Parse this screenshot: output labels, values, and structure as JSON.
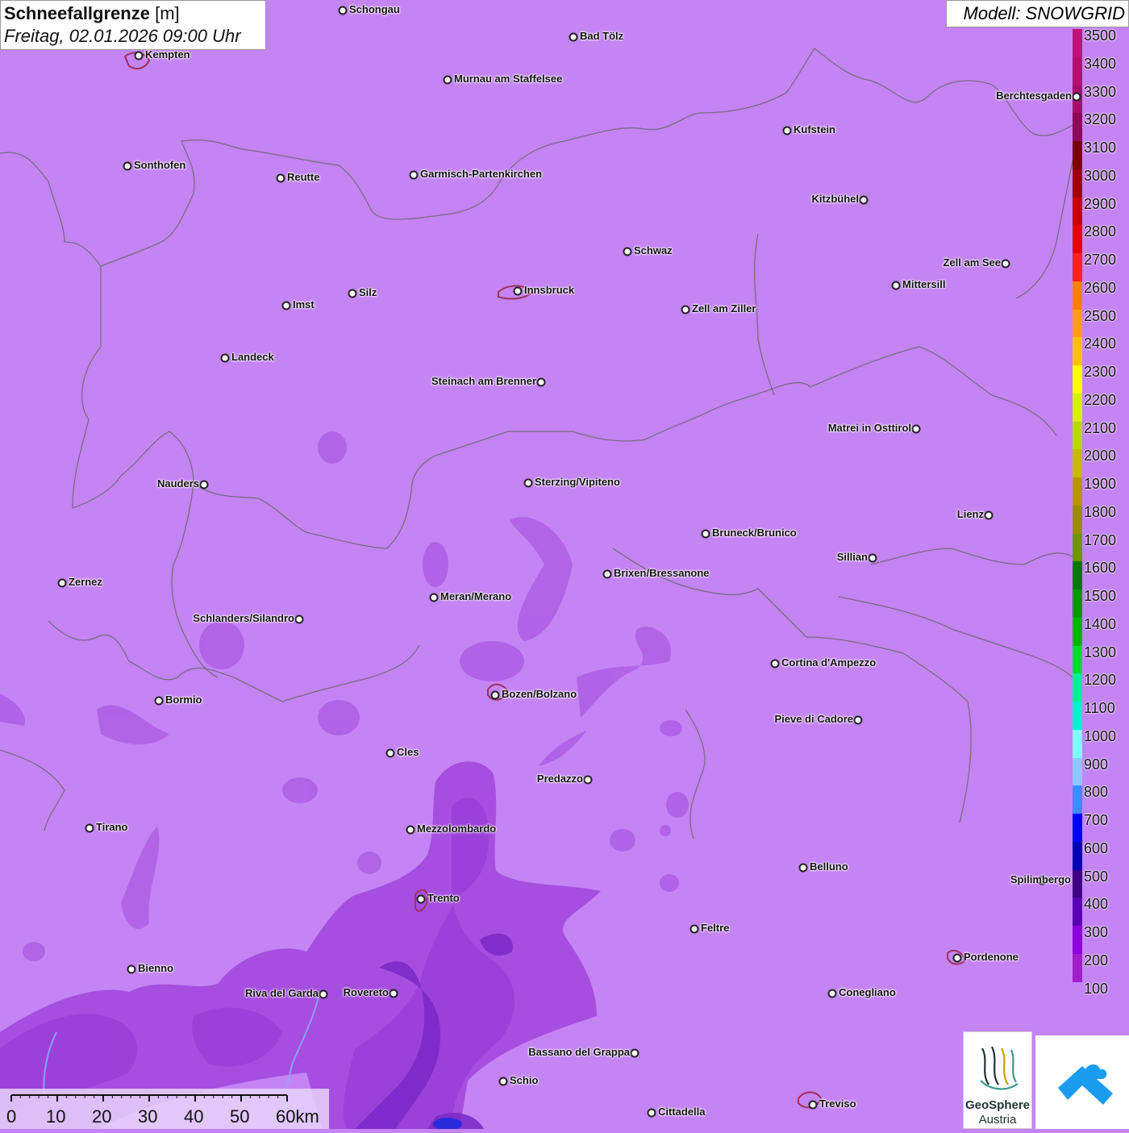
{
  "header": {
    "title": "Schneefallgrenze",
    "unit": "[m]",
    "datetime": "Freitag, 02.01.2026 09:00 Uhr",
    "model": "Modell: SNOWGRID"
  },
  "legend": {
    "levels": [
      {
        "label": "3500",
        "color": "#c2127a"
      },
      {
        "label": "3400",
        "color": "#b80e73"
      },
      {
        "label": "3300",
        "color": "#a80c6a"
      },
      {
        "label": "3200",
        "color": "#8c0858"
      },
      {
        "label": "3100",
        "color": "#7a0000"
      },
      {
        "label": "3000",
        "color": "#a00000"
      },
      {
        "label": "2900",
        "color": "#c80000"
      },
      {
        "label": "2800",
        "color": "#e60000"
      },
      {
        "label": "2700",
        "color": "#ff2020"
      },
      {
        "label": "2600",
        "color": "#ff7f00"
      },
      {
        "label": "2500",
        "color": "#ff9f10"
      },
      {
        "label": "2400",
        "color": "#ffc000"
      },
      {
        "label": "2300",
        "color": "#ffff00"
      },
      {
        "label": "2200",
        "color": "#d6f000"
      },
      {
        "label": "2100",
        "color": "#b8d800"
      },
      {
        "label": "2000",
        "color": "#c8b800"
      },
      {
        "label": "1900",
        "color": "#b89400"
      },
      {
        "label": "1800",
        "color": "#9c8c00"
      },
      {
        "label": "1700",
        "color": "#6e9600"
      },
      {
        "label": "1600",
        "color": "#007800"
      },
      {
        "label": "1500",
        "color": "#009600"
      },
      {
        "label": "1400",
        "color": "#00b400"
      },
      {
        "label": "1300",
        "color": "#00dc32"
      },
      {
        "label": "1200",
        "color": "#00f096"
      },
      {
        "label": "1100",
        "color": "#00f0d2"
      },
      {
        "label": "1000",
        "color": "#80ffff"
      },
      {
        "label": "900",
        "color": "#8cc8ff"
      },
      {
        "label": "800",
        "color": "#3c8cff"
      },
      {
        "label": "700",
        "color": "#0000ff"
      },
      {
        "label": "600",
        "color": "#0000b4"
      },
      {
        "label": "500",
        "color": "#3c0082"
      },
      {
        "label": "400",
        "color": "#5a00b4"
      },
      {
        "label": "300",
        "color": "#8c00dc"
      },
      {
        "label": "200",
        "color": "#a01ec8"
      },
      {
        "label": "100",
        "color": "#c484f4"
      }
    ]
  },
  "cities": [
    {
      "name": "Schongau",
      "label_side": "right"
    },
    {
      "name": "Bad Tölz",
      "label_side": "right"
    },
    {
      "name": "Kempten",
      "label_side": "right"
    },
    {
      "name": "Murnau am Staffelsee",
      "label_side": "right"
    },
    {
      "name": "Berchtesgaden",
      "label_side": "left"
    },
    {
      "name": "Kufstein",
      "label_side": "right"
    },
    {
      "name": "Sonthofen",
      "label_side": "right"
    },
    {
      "name": "Reutte",
      "label_side": "right"
    },
    {
      "name": "Garmisch-Partenkirchen",
      "label_side": "right"
    },
    {
      "name": "Kitzbühel",
      "label_side": "left"
    },
    {
      "name": "Schwaz",
      "label_side": "right"
    },
    {
      "name": "Zell am See",
      "label_side": "left"
    },
    {
      "name": "Innsbruck",
      "label_side": "right"
    },
    {
      "name": "Mittersill",
      "label_side": "right"
    },
    {
      "name": "Silz",
      "label_side": "right"
    },
    {
      "name": "Imst",
      "label_side": "right"
    },
    {
      "name": "Zell am Ziller",
      "label_side": "right"
    },
    {
      "name": "Landeck",
      "label_side": "right"
    },
    {
      "name": "Steinach am Brenner",
      "label_side": "left"
    },
    {
      "name": "Matrei in Osttirol",
      "label_side": "left"
    },
    {
      "name": "Nauders",
      "label_side": "left"
    },
    {
      "name": "Sterzing/Vipiteno",
      "label_side": "right"
    },
    {
      "name": "Lienz",
      "label_side": "left"
    },
    {
      "name": "Bruneck/Brunico",
      "label_side": "right"
    },
    {
      "name": "Sillian",
      "label_side": "left"
    },
    {
      "name": "Brixen/Bressanone",
      "label_side": "right"
    },
    {
      "name": "Zernez",
      "label_side": "right"
    },
    {
      "name": "Meran/Merano",
      "label_side": "right"
    },
    {
      "name": "Schlanders/Silandro",
      "label_side": "left"
    },
    {
      "name": "Cortina d'Ampezzo",
      "label_side": "right"
    },
    {
      "name": "Bozen/Bolzano",
      "label_side": "right"
    },
    {
      "name": "Bormio",
      "label_side": "right"
    },
    {
      "name": "Pieve di Cadore",
      "label_side": "left"
    },
    {
      "name": "Cles",
      "label_side": "right"
    },
    {
      "name": "Predazzo",
      "label_side": "left"
    },
    {
      "name": "Tirano",
      "label_side": "right"
    },
    {
      "name": "Mezzolombardo",
      "label_side": "right"
    },
    {
      "name": "Belluno",
      "label_side": "right"
    },
    {
      "name": "Spilimbergo",
      "label_side": "right"
    },
    {
      "name": "Trento",
      "label_side": "right"
    },
    {
      "name": "Feltre",
      "label_side": "right"
    },
    {
      "name": "Pordenone",
      "label_side": "right"
    },
    {
      "name": "Bienno",
      "label_side": "right"
    },
    {
      "name": "Riva del Garda",
      "label_side": "left"
    },
    {
      "name": "Rovereto",
      "label_side": "left"
    },
    {
      "name": "Conegliano",
      "label_side": "right"
    },
    {
      "name": "Bassano del Grappa",
      "label_side": "left"
    },
    {
      "name": "Schio",
      "label_side": "right"
    },
    {
      "name": "Cittadella",
      "label_side": "right"
    },
    {
      "name": "Treviso",
      "label_side": "right"
    }
  ],
  "scalebar": {
    "ticks": [
      "0",
      "10",
      "20",
      "30",
      "40",
      "50",
      "60km"
    ]
  },
  "logos": {
    "geosphere_line1": "GeoSphere",
    "geosphere_line2": "Austria"
  },
  "colors": {
    "base": "#c484f4",
    "border": "#666666"
  }
}
